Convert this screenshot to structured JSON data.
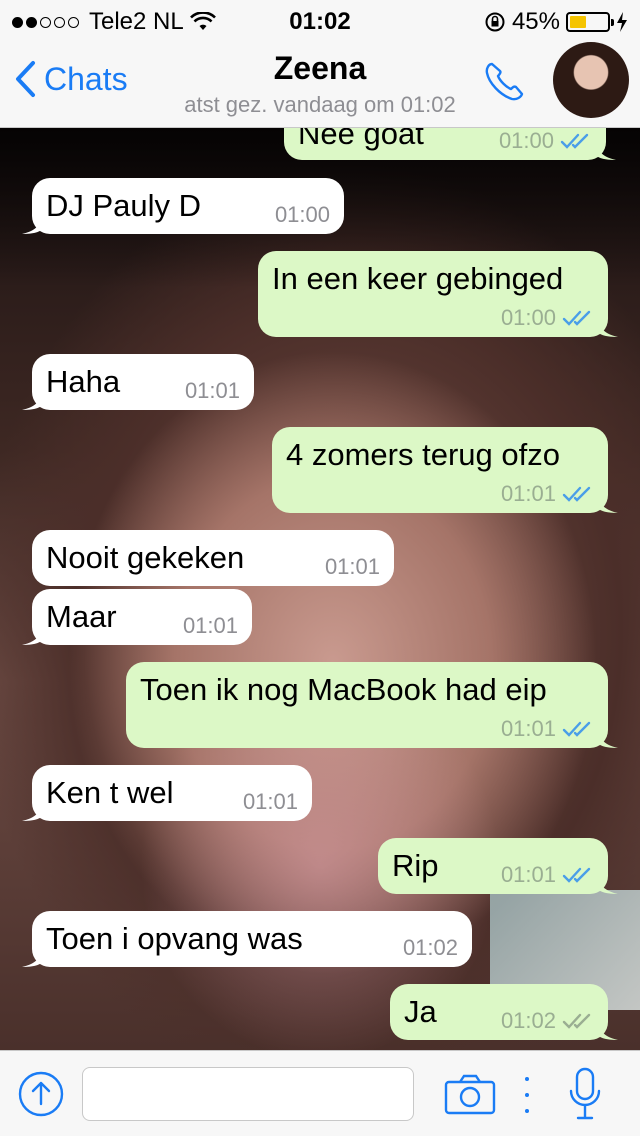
{
  "status_bar": {
    "carrier": "Tele2 NL",
    "time": "01:02",
    "battery_percent": "45%",
    "battery_level": 0.45,
    "signal_bars": 2
  },
  "nav": {
    "back_label": "Chats",
    "contact_name": "Zeena",
    "last_seen": "atst gez. vandaag om 01:02"
  },
  "colors": {
    "accent": "#1a7cf5",
    "outgoing_bubble": "#dcf8c6",
    "incoming_bubble": "#ffffff",
    "read_ticks": "#4a9ee8"
  },
  "messages": [
    {
      "dir": "out",
      "text": "Nee goat",
      "time": "01:00",
      "status": "read"
    },
    {
      "dir": "in",
      "text": "DJ Pauly D",
      "time": "01:00"
    },
    {
      "dir": "out",
      "text": "In een keer gebinged",
      "time": "01:00",
      "status": "read"
    },
    {
      "dir": "in",
      "text": "Haha",
      "time": "01:01"
    },
    {
      "dir": "out",
      "text": "4 zomers terug ofzo",
      "time": "01:01",
      "status": "read"
    },
    {
      "dir": "in",
      "text": "Nooit gekeken",
      "time": "01:01"
    },
    {
      "dir": "in",
      "text": "Maar",
      "time": "01:01"
    },
    {
      "dir": "out",
      "text": "Toen ik nog MacBook had eip",
      "time": "01:01",
      "status": "read"
    },
    {
      "dir": "in",
      "text": "Ken t wel",
      "time": "01:01"
    },
    {
      "dir": "out",
      "text": "Rip",
      "time": "01:01",
      "status": "read"
    },
    {
      "dir": "in",
      "text": "Toen i opvang was",
      "time": "01:02"
    },
    {
      "dir": "out",
      "text": "Ja",
      "time": "01:02",
      "status": "delivered"
    }
  ],
  "input": {
    "placeholder": "",
    "icons": [
      "share-icon",
      "camera-icon",
      "mic-icon"
    ]
  }
}
